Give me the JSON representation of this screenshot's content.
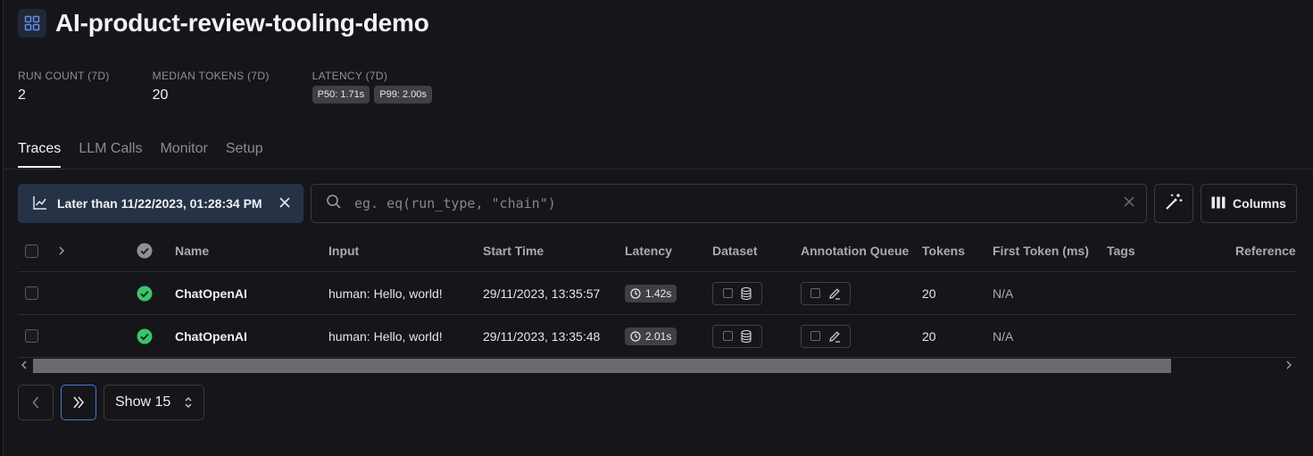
{
  "project": {
    "title": "AI-product-review-tooling-demo",
    "icon": "grid-icon"
  },
  "stats": [
    {
      "label": "RUN COUNT (7D)",
      "value": "2"
    },
    {
      "label": "MEDIAN TOKENS (7D)",
      "value": "20"
    },
    {
      "label": "LATENCY (7D)",
      "pills": [
        "P50: 1.71s",
        "P99: 2.00s"
      ]
    }
  ],
  "tabs": [
    {
      "label": "Traces",
      "active": true
    },
    {
      "label": "LLM Calls",
      "active": false
    },
    {
      "label": "Monitor",
      "active": false
    },
    {
      "label": "Setup",
      "active": false
    }
  ],
  "toolbar": {
    "filter_label": "Later than 11/22/2023, 01:28:34 PM",
    "search_placeholder": "eg. eq(run_type, \"chain\")",
    "columns_label": "Columns"
  },
  "table": {
    "headers": {
      "name": "Name",
      "input": "Input",
      "start_time": "Start Time",
      "latency": "Latency",
      "dataset": "Dataset",
      "annotation_queue": "Annotation Queue",
      "tokens": "Tokens",
      "first_token": "First Token (ms)",
      "tags": "Tags",
      "reference": "Reference"
    },
    "rows": [
      {
        "name": "ChatOpenAI",
        "input": "human: Hello, world!",
        "start_time": "29/11/2023, 13:35:57",
        "latency": "1.42s",
        "tokens": "20",
        "first_token": "N/A",
        "status": "success"
      },
      {
        "name": "ChatOpenAI",
        "input": "human: Hello, world!",
        "start_time": "29/11/2023, 13:35:48",
        "latency": "2.01s",
        "tokens": "20",
        "first_token": "N/A",
        "status": "success"
      }
    ]
  },
  "pagination": {
    "show_label": "Show 15"
  },
  "colors": {
    "success": "#3cc46a",
    "accent": "#3f7bd8",
    "filter_bg": "#263246"
  }
}
